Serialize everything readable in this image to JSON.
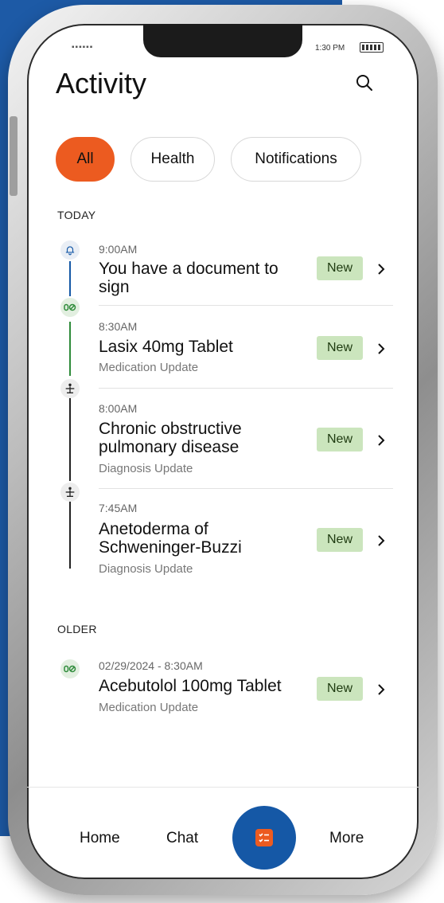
{
  "status_bar": {
    "signal": "▪▪▪▪▪▪",
    "time": "1:30 PM"
  },
  "header": {
    "title": "Activity",
    "search_icon": "search-icon"
  },
  "filters": [
    {
      "label": "All",
      "active": true
    },
    {
      "label": "Health",
      "active": false
    },
    {
      "label": "Notifications",
      "active": false
    }
  ],
  "sections": {
    "today_label": "TODAY",
    "older_label": "OLDER"
  },
  "today_items": [
    {
      "time": "9:00AM",
      "title": "You have a document to sign",
      "subtitle": "",
      "badge": "New",
      "icon": "bell-icon"
    },
    {
      "time": "8:30AM",
      "title": "Lasix 40mg Tablet",
      "subtitle": "Medication Update",
      "badge": "New",
      "icon": "pill-icon"
    },
    {
      "time": "8:00AM",
      "title": "Chronic obstructive pulmonary disease",
      "subtitle": "Diagnosis Update",
      "badge": "New",
      "icon": "diagnosis-icon"
    },
    {
      "time": "7:45AM",
      "title": "Anetoderma of Schweninger-Buzzi",
      "subtitle": "Diagnosis Update",
      "badge": "New",
      "icon": "diagnosis-icon"
    }
  ],
  "older_items": [
    {
      "time": "02/29/2024 - 8:30AM",
      "title": "Acebutolol 100mg Tablet",
      "subtitle": "Medication Update",
      "badge": "New",
      "icon": "pill-icon"
    }
  ],
  "bottom_nav": {
    "home": "Home",
    "chat": "Chat",
    "more": "More",
    "center_icon": "task-list-icon"
  },
  "colors": {
    "accent_orange": "#ec5b20",
    "primary_blue": "#1558a6",
    "badge_green": "#cbe5bd",
    "timeline_blue": "#1558a6",
    "timeline_green": "#2e8b3a"
  }
}
